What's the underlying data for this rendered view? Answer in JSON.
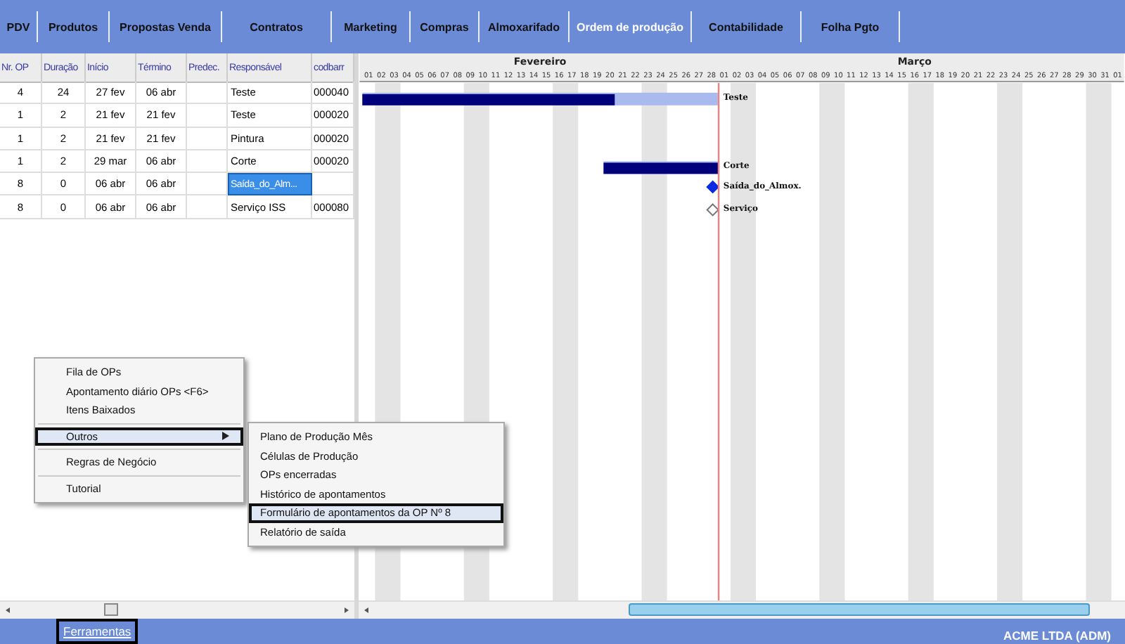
{
  "nav": [
    {
      "label": "PDV",
      "selected": false
    },
    {
      "label": "Produtos",
      "selected": false
    },
    {
      "label": "Propostas Venda",
      "selected": false
    },
    {
      "label": "Contratos",
      "selected": false
    },
    {
      "label": "Marketing",
      "selected": false
    },
    {
      "label": "Compras",
      "selected": false
    },
    {
      "label": "Almoxarifado",
      "selected": false
    },
    {
      "label": "Ordem de produção",
      "selected": true
    },
    {
      "label": "Contabilidade",
      "selected": false
    },
    {
      "label": "Folha Pgto",
      "selected": false
    }
  ],
  "table": {
    "columns": [
      "Nr. OP",
      "Duração",
      "Início",
      "Término",
      "Predec.",
      "Responsável",
      "codbarr"
    ],
    "rows": [
      {
        "cells": [
          "4",
          "24",
          "27 fev",
          "06 abr",
          "",
          "Teste",
          "000040"
        ],
        "selected": false
      },
      {
        "cells": [
          "1",
          "2",
          "21 fev",
          "21 fev",
          "",
          "Teste",
          "000020"
        ],
        "selected": false
      },
      {
        "cells": [
          "1",
          "2",
          "21 fev",
          "21 fev",
          "",
          "Pintura",
          "000020"
        ],
        "selected": false
      },
      {
        "cells": [
          "1",
          "2",
          "29 mar",
          "06 abr",
          "",
          "Corte",
          "000020"
        ],
        "selected": false
      },
      {
        "cells": [
          "8",
          "0",
          "06 abr",
          "06 abr",
          "",
          "Saída_do_Alm...",
          ""
        ],
        "selected": true
      },
      {
        "cells": [
          "8",
          "0",
          "06 abr",
          "06 abr",
          "",
          "Serviço ISS",
          "000080"
        ],
        "selected": false
      }
    ]
  },
  "gantt": {
    "months": [
      {
        "name": "Fevereiro",
        "days": [
          "01",
          "02",
          "03",
          "04",
          "05",
          "06",
          "07",
          "08",
          "09",
          "10",
          "11",
          "12",
          "13",
          "14",
          "15",
          "16",
          "17",
          "18",
          "19",
          "20",
          "21",
          "22",
          "23",
          "24",
          "25",
          "26",
          "27",
          "28"
        ]
      },
      {
        "name": "Março",
        "days": [
          "01",
          "02",
          "03",
          "04",
          "05",
          "06",
          "07",
          "08",
          "09",
          "10",
          "11",
          "12",
          "13",
          "14",
          "15",
          "16",
          "17",
          "18",
          "19",
          "20",
          "21",
          "22",
          "23",
          "24",
          "25",
          "26",
          "27",
          "28",
          "29",
          "30",
          "31"
        ]
      },
      {
        "days": [
          "01"
        ]
      }
    ],
    "tasks": [
      {
        "kind": "bar",
        "label": "Teste",
        "level": 0.71
      },
      {
        "kind": "none"
      },
      {
        "kind": "none"
      },
      {
        "kind": "bar",
        "label": "Corte",
        "level": 1
      },
      {
        "kind": "milestone",
        "label": "Saída_do_Almox.",
        "filled": true
      },
      {
        "kind": "milestone",
        "label": "Serviço",
        "filled": false
      }
    ]
  },
  "tools_menu": {
    "items": [
      {
        "kind": "item",
        "label": "Fila de OPs",
        "selected": false
      },
      {
        "kind": "item",
        "label": "Apontamento diário OPs <F6>",
        "selected": false
      },
      {
        "kind": "item",
        "label": "Itens Baixados",
        "selected": false
      },
      {
        "kind": "separator"
      },
      {
        "kind": "submenu",
        "label": "Outros",
        "selected": true
      },
      {
        "kind": "separator"
      },
      {
        "kind": "item",
        "label": "Regras de Negócio",
        "selected": false
      },
      {
        "kind": "separator"
      },
      {
        "kind": "item",
        "label": "Tutorial",
        "selected": false
      }
    ]
  },
  "submenu": {
    "items": [
      {
        "label": "Plano de Produção Mês",
        "selected": false
      },
      {
        "label": "Células de Produção",
        "selected": false
      },
      {
        "label": "OPs encerradas",
        "selected": false
      },
      {
        "label": "Histórico de apontamentos",
        "selected": false
      },
      {
        "label": "Formulário de apontamentos da OP Nº 8",
        "selected": true
      },
      {
        "label": "Relatório de saída",
        "selected": false
      }
    ]
  },
  "status_bar": {
    "menu": {
      "label": "Ferramentas",
      "selected": true
    },
    "company": "ACME LTDA (ADM)"
  }
}
